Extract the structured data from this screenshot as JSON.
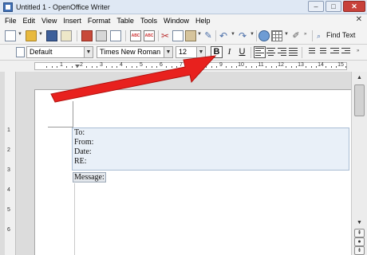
{
  "window": {
    "title": "Untitled 1 - OpenOffice Writer",
    "minimize": "–",
    "maximize": "□",
    "close": "✕"
  },
  "menu": {
    "items": [
      "File",
      "Edit",
      "View",
      "Insert",
      "Format",
      "Table",
      "Tools",
      "Window",
      "Help"
    ],
    "close_doc": "✕"
  },
  "toolbar": {
    "spellcheck_label": "ABC",
    "autospell_label": "ABC",
    "find_text_label": "Find Text"
  },
  "formatting": {
    "paragraph_style": "Default",
    "font_name": "Times New Roman",
    "font_size": "12",
    "bold_label": "B",
    "italic_label": "I",
    "underline_label": "U"
  },
  "ruler": {
    "numbers": [
      "1",
      "2",
      "3",
      "4",
      "5",
      "6",
      "7",
      "8",
      "9",
      "10",
      "11",
      "12",
      "13",
      "14",
      "15"
    ]
  },
  "vruler": {
    "numbers": [
      "1",
      "2",
      "3",
      "4",
      "5",
      "6"
    ]
  },
  "document": {
    "lines": [
      "To:",
      "From:",
      "Date:",
      "RE:"
    ],
    "message": "Message:"
  },
  "colors": {
    "arrow": "#e8211e",
    "frame_fill": "#e9f0f8",
    "close_button": "#c8413a"
  },
  "icons": [
    "new-document-icon",
    "open-folder-icon",
    "save-icon",
    "email-icon",
    "pdf-export-icon",
    "print-icon",
    "print-preview-icon",
    "spellcheck-icon",
    "autospellcheck-icon",
    "cut-icon",
    "copy-icon",
    "paste-icon",
    "format-paintbrush-icon",
    "undo-icon",
    "redo-icon",
    "hyperlink-icon",
    "table-icon",
    "show-draw-functions-icon",
    "find-icon"
  ]
}
